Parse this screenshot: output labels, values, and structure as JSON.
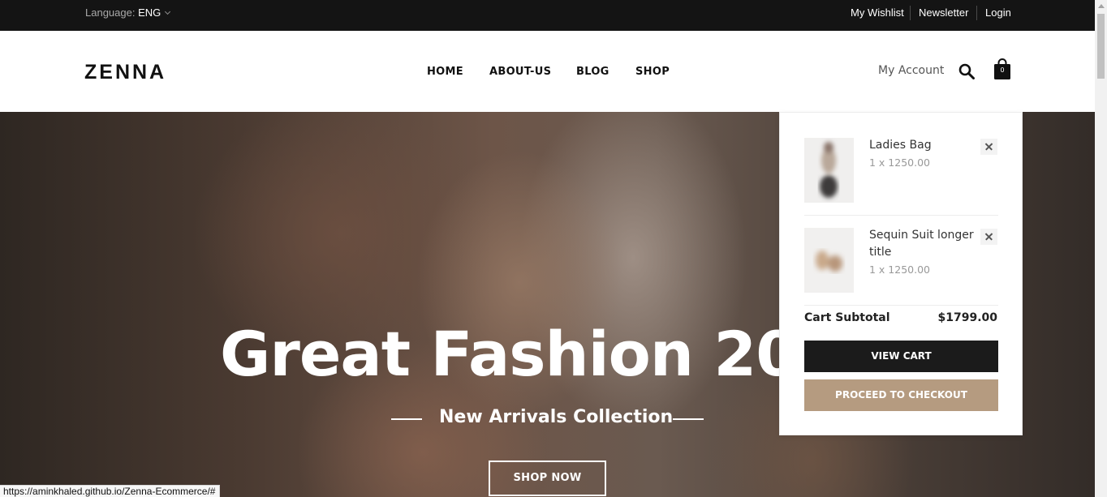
{
  "topbar": {
    "language_label": "Language:",
    "language_value": "ENG",
    "links": [
      "My Wishlist",
      "Newsletter",
      "Login"
    ]
  },
  "header": {
    "logo": "ZENNA",
    "nav": [
      "HOME",
      "ABOUT-US",
      "BLOG",
      "SHOP"
    ],
    "account": "My Account",
    "cart_count": "0"
  },
  "hero": {
    "title": "Great Fashion 2024",
    "subtitle": "New Arrivals Collection",
    "cta": "SHOP NOW"
  },
  "cart": {
    "items": [
      {
        "name": "Ladies Bag",
        "qty": "1 x 1250.00"
      },
      {
        "name": "Sequin Suit longer title",
        "qty": "1 x 1250.00"
      }
    ],
    "subtotal_label": "Cart Subtotal",
    "subtotal_value": "$1799.00",
    "view_cart": "VIEW CART",
    "checkout": "PROCEED TO CHECKOUT"
  },
  "status_url": "https://aminkhaled.github.io/Zenna-Ecommerce/#",
  "colors": {
    "topbar": "#141414",
    "accent": "#b59b80",
    "dark_button": "#1b1b1b"
  }
}
